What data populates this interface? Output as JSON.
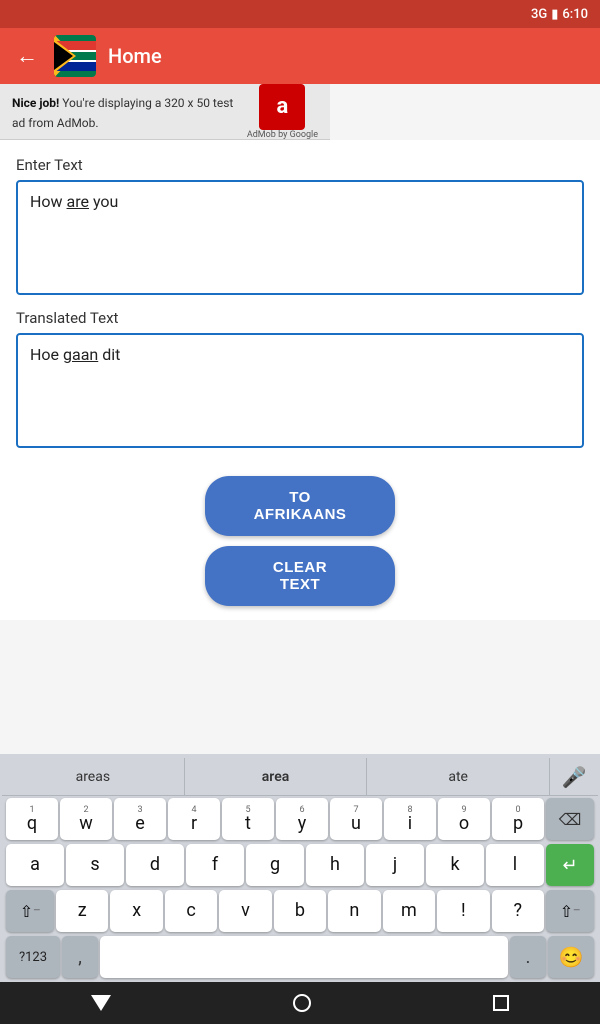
{
  "status_bar": {
    "signal": "3G",
    "battery_icon": "🔋",
    "time": "6:10"
  },
  "top_bar": {
    "title": "Home",
    "back_label": "←"
  },
  "ad_banner": {
    "bold_text": "Nice job!",
    "message": " You're displaying a 320 x 50 test ad from AdMob.",
    "logo_letter": "a",
    "logo_by": "AdMob by Google"
  },
  "enter_text_label": "Enter Text",
  "input_text": "How are you",
  "translated_text_label": "Translated Text",
  "translated_text": "Hoe gaan dit",
  "btn_translate": "TO AFRIKAANS",
  "btn_clear": "CLEAR TEXT",
  "keyboard": {
    "autocomplete": [
      "areas",
      "area",
      "ate"
    ],
    "rows": [
      {
        "type": "letters_with_num",
        "keys": [
          {
            "num": "1",
            "letter": "q"
          },
          {
            "num": "2",
            "letter": "w"
          },
          {
            "num": "3",
            "letter": "e"
          },
          {
            "num": "4",
            "letter": "r"
          },
          {
            "num": "5",
            "letter": "t"
          },
          {
            "num": "6",
            "letter": "y"
          },
          {
            "num": "7",
            "letter": "u"
          },
          {
            "num": "8",
            "letter": "i"
          },
          {
            "num": "9",
            "letter": "o"
          },
          {
            "num": "0",
            "letter": "p"
          }
        ]
      },
      {
        "type": "letters",
        "keys": [
          "a",
          "s",
          "d",
          "f",
          "g",
          "h",
          "j",
          "k",
          "l"
        ]
      },
      {
        "type": "special",
        "keys": [
          "z",
          "x",
          "c",
          "v",
          "b",
          "n",
          "m",
          "!",
          "?"
        ]
      }
    ],
    "bottom": {
      "num_label": "?123",
      "comma": ",",
      "period": ".",
      "emoji": "😊"
    }
  },
  "nav_bar": {
    "back": "▽",
    "home": "○",
    "recents": "□"
  }
}
